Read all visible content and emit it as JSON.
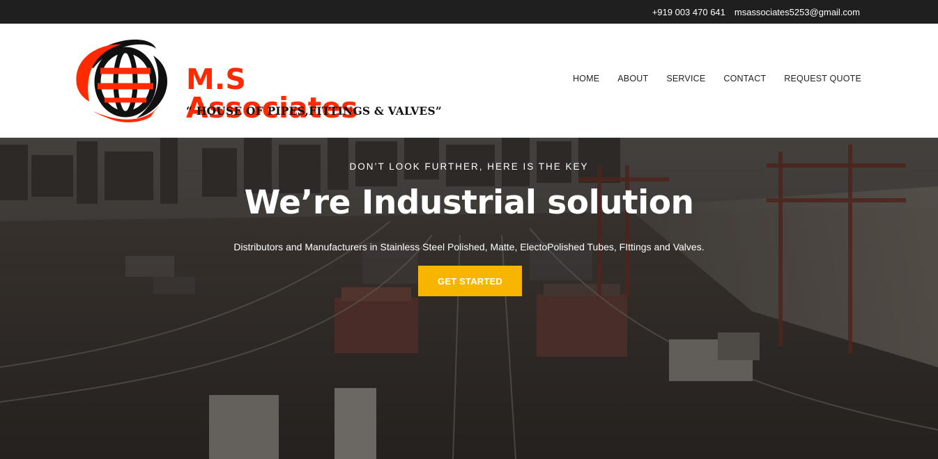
{
  "topbar": {
    "phone": "+919 003 470 641",
    "email": "msassociates5253@gmail.com"
  },
  "brand": {
    "name": "M.S Associates",
    "tagline": "“ HOUSE OF PIPES,FITTINGS & VALVES”",
    "colors": {
      "accent": "#ff2a00",
      "dark": "#111111"
    }
  },
  "nav": {
    "items": [
      {
        "label": "HOME"
      },
      {
        "label": "ABOUT"
      },
      {
        "label": "SERVICE"
      },
      {
        "label": "CONTACT"
      },
      {
        "label": "REQUEST QUOTE"
      }
    ]
  },
  "hero": {
    "eyebrow": "DON’T LOOK FURTHER, HERE IS THE KEY",
    "headline": "We’re Industrial solution",
    "subtitle": "Distributors and Manufacturers in Stainless Steel Polished, Matte, ElectoPolished Tubes, FIttings and Valves.",
    "cta_label": "GET STARTED",
    "cta_color": "#f7b500"
  }
}
